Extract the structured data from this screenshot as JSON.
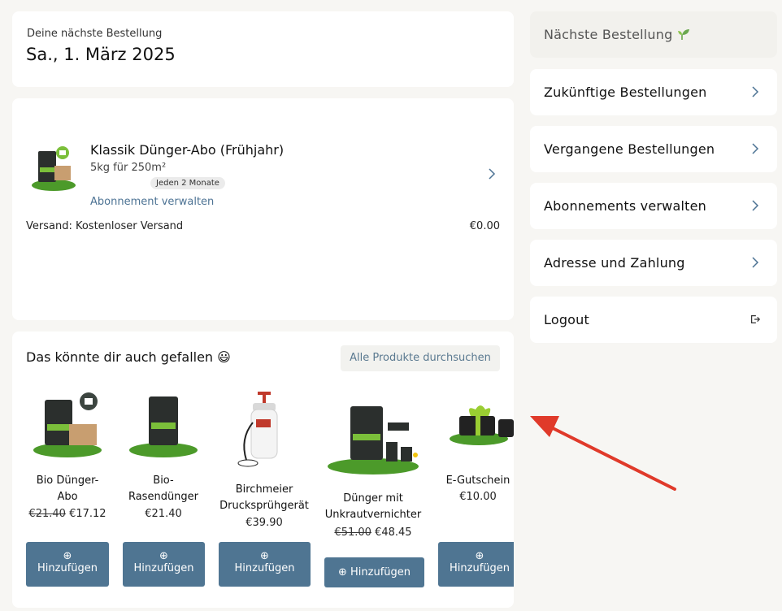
{
  "next_order": {
    "label": "Deine nächste Bestellung",
    "date": "Sa., 1. März 2025"
  },
  "order": {
    "product_name": "Klassik Dünger-Abo (Frühjahr)",
    "size": "5kg für 250m²",
    "frequency": "Jeden 2 Monate",
    "manage_link": "Abonnement verwalten",
    "shipping_label": "Versand: Kostenloser Versand",
    "shipping_price": "€0.00"
  },
  "recommendations": {
    "title": "Das könnte dir auch gefallen 😃",
    "browse_button": "Alle Produkte durchsuchen",
    "items": [
      {
        "name": "Bio Dünger-Abo",
        "old_price": "€21.40",
        "price": "€17.12",
        "button": "Hinzufügen"
      },
      {
        "name": "Bio-Rasendünger",
        "old_price": "",
        "price": "€21.40",
        "button": "Hinzufügen"
      },
      {
        "name": "Birchmeier Drucksprühgerät",
        "old_price": "",
        "price": "€39.90",
        "button": "Hinzufügen"
      },
      {
        "name": "Dünger mit Unkrautvernichter",
        "old_price": "€51.00",
        "price": "€48.45",
        "button": "Hinzufügen"
      },
      {
        "name": "E-Gutschein",
        "old_price": "",
        "price": "€10.00",
        "button": "Hinzufügen"
      }
    ]
  },
  "sidebar": {
    "items": [
      {
        "label": "Nächste Bestellung",
        "icon": "sprout-icon"
      },
      {
        "label": "Zukünftige Bestellungen",
        "icon": "chevron-right-icon"
      },
      {
        "label": "Vergangene Bestellungen",
        "icon": "chevron-right-icon"
      },
      {
        "label": "Abonnements verwalten",
        "icon": "chevron-right-icon"
      },
      {
        "label": "Adresse und Zahlung",
        "icon": "chevron-right-icon"
      },
      {
        "label": "Logout",
        "icon": "logout-icon"
      }
    ]
  },
  "colors": {
    "page_bg": "#f7f6f3",
    "button": "#4f7592",
    "link": "#4d7394",
    "arrow": "#e03a2a"
  }
}
